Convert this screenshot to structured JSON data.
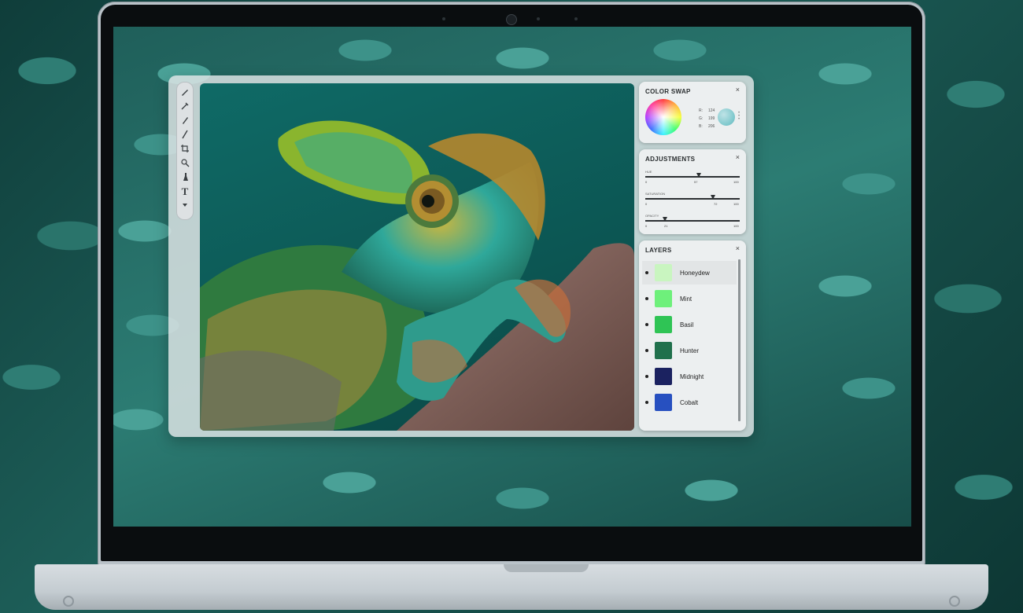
{
  "app": {
    "tools": [
      "brush-tool",
      "eyedropper-tool",
      "pen-tool",
      "line-tool",
      "crop-tool",
      "zoom-tool",
      "paint-tool",
      "text-tool",
      "more-tool"
    ],
    "text_tool_glyph": "T"
  },
  "color_swap": {
    "title": "COLOR SWAP",
    "close": "×",
    "rgb": [
      {
        "label": "R:",
        "value": "124"
      },
      {
        "label": "G:",
        "value": "199"
      },
      {
        "label": "B:",
        "value": "206"
      }
    ],
    "swatch_color": "#7cc7cc"
  },
  "adjustments": {
    "title": "ADJUSTMENTS",
    "close": "×",
    "sliders": [
      {
        "label": "Hue",
        "min": "0",
        "max": "100",
        "value": "57"
      },
      {
        "label": "Saturation",
        "min": "0",
        "max": "100",
        "value": "72"
      },
      {
        "label": "Opacity",
        "min": "0",
        "max": "100",
        "value": "21"
      }
    ]
  },
  "layers": {
    "title": "LAYERS",
    "close": "×",
    "items": [
      {
        "name": "Honeydew",
        "color": "#c9f5c0"
      },
      {
        "name": "Mint",
        "color": "#6ef07b"
      },
      {
        "name": "Basil",
        "color": "#2fc455"
      },
      {
        "name": "Hunter",
        "color": "#20704c"
      },
      {
        "name": "Midnight",
        "color": "#1b2260"
      },
      {
        "name": "Cobalt",
        "color": "#2750c0"
      }
    ]
  }
}
